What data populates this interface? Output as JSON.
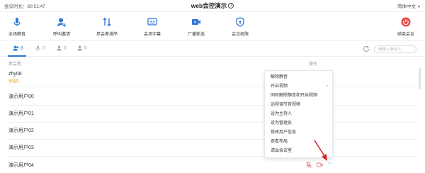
{
  "header": {
    "meeting_time": "会议时长：80:51:47",
    "title": "web会控演示",
    "info_glyph": "i",
    "language": "简体中文"
  },
  "toolbar": {
    "items": [
      {
        "label": "全场静音",
        "icon": "microphone-icon"
      },
      {
        "label": "呼叫邀请",
        "icon": "add-user-icon"
      },
      {
        "label": "参会者排序",
        "icon": "sort-icon"
      },
      {
        "label": "会场字幕",
        "icon": "subtitle-icon"
      },
      {
        "label": "广播轮巡",
        "icon": "broadcast-icon"
      },
      {
        "label": "会议权限",
        "icon": "shield-icon"
      },
      {
        "label": "结束会议",
        "icon": "power-icon"
      }
    ],
    "accent_color": "#2f76d6",
    "end_color": "#e84545"
  },
  "tabs": {
    "items": [
      {
        "count": "8"
      },
      {
        "count": "0"
      },
      {
        "count": "0"
      },
      {
        "count": "0"
      }
    ],
    "search_placeholder": "请输入参会人"
  },
  "table": {
    "col_participant": "参会者",
    "col_action": "操作",
    "rows": [
      {
        "name": "zhy08",
        "role": "管理员"
      },
      {
        "name": "演示用户00",
        "role": ""
      },
      {
        "name": "演示用户01",
        "role": ""
      },
      {
        "name": "演示用户02",
        "role": ""
      },
      {
        "name": "演示用户03",
        "role": ""
      },
      {
        "name": "演示用户04",
        "role": ""
      }
    ],
    "more_glyph": "···"
  },
  "context_menu": {
    "items": [
      "解除静音",
      "开启视频",
      "同时解除静音和开启视频",
      "远程调节音视频",
      "设为主持人",
      "设为管理员",
      "修改用户信息",
      "查看布局",
      "请出会议室"
    ],
    "submenu_chevron": "›"
  }
}
